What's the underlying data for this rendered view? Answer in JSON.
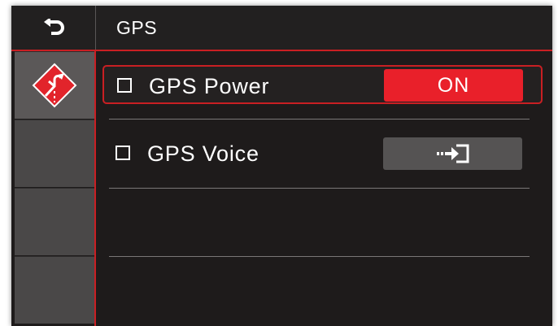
{
  "header": {
    "back_icon": "back-arrow-icon",
    "title": "GPS"
  },
  "sidebar": {
    "items": [
      {
        "icon": "road-warning-icon",
        "selected": true
      },
      {
        "icon": "",
        "selected": false
      },
      {
        "icon": "",
        "selected": false
      },
      {
        "icon": "",
        "selected": false
      }
    ]
  },
  "settings": [
    {
      "label": "GPS Power",
      "control": "toggle",
      "value": "ON",
      "selected": true
    },
    {
      "label": "GPS Voice",
      "control": "enter",
      "icon": "enter-arrow-icon",
      "selected": false
    }
  ],
  "colors": {
    "accent": "#c91f23",
    "toggle_on": "#e9202a",
    "background": "#1e1b1b",
    "tab": "#4a4848"
  }
}
